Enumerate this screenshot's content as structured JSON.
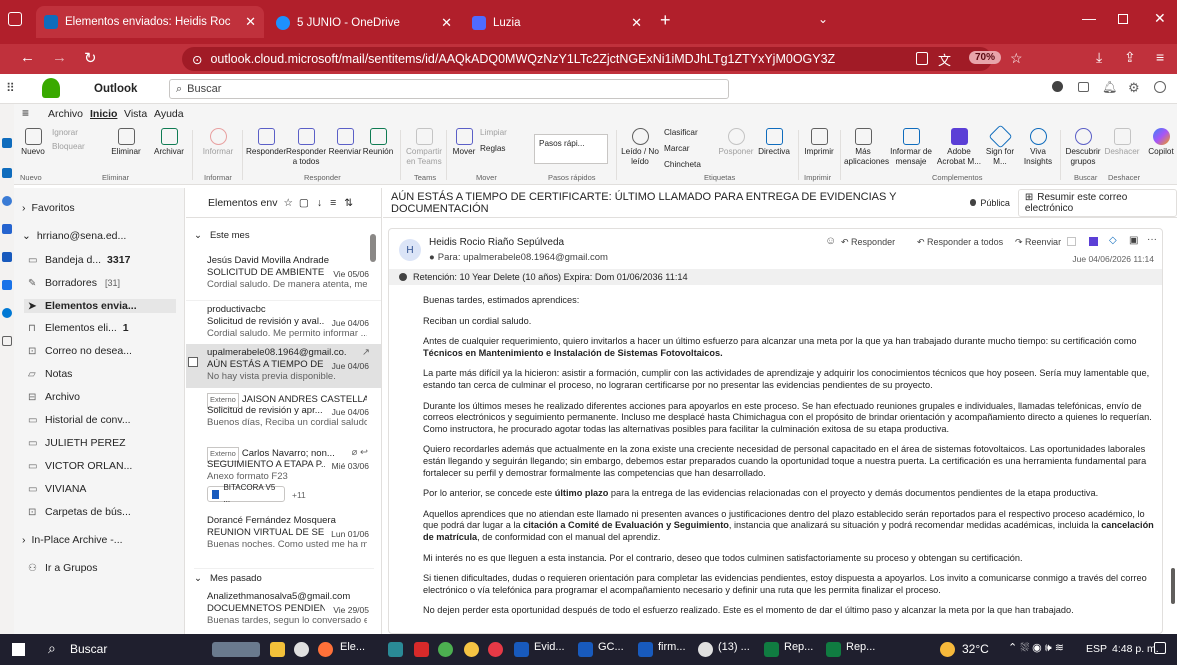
{
  "browser": {
    "tabs": [
      {
        "title": "Elementos enviados: Heidis Roc"
      },
      {
        "title": "5 JUNIO - OneDrive"
      },
      {
        "title": "Luzia"
      }
    ],
    "url": "outlook.cloud.microsoft/mail/sentitems/id/AAQkADQ0MWQzNzY1LTc2ZjctNGExNi1iMDJhLTg1ZTYxYjM0OGY3Z",
    "zoom": "70%"
  },
  "outlook": {
    "app_name": "Outlook",
    "search_placeholder": "Buscar",
    "menu": [
      "Archivo",
      "Inicio",
      "Vista",
      "Ayuda"
    ],
    "ribbon": {
      "nuevo": "Nuevo",
      "ignorar": "Ignorar",
      "bloquear": "Bloquear",
      "eliminar": "Eliminar",
      "archivar": "Archivar",
      "informar": "Informar",
      "responder": "Responder",
      "responder_todos": "Responder a todos",
      "reenviar": "Reenviar",
      "reunion": "Reunión",
      "compartir_teams": "Compartir en Teams",
      "mover": "Mover",
      "limpiar": "Limpiar",
      "reglas": "Reglas",
      "pasos_rapidos": "Pasos rápi...",
      "leido": "Leído / No leído",
      "clasificar": "Clasificar",
      "marcar": "Marcar",
      "chincheta": "Chincheta",
      "posponer": "Posponer",
      "directiva": "Directiva",
      "imprimir": "Imprimir",
      "mas_aplicaciones": "Más aplicaciones",
      "informar_mensaje": "Informar de mensaje",
      "adobe": "Adobe Acrobat M...",
      "sign_for": "Sign for M...",
      "viva_insights": "Viva Insights",
      "descubrir": "Descubrir grupos",
      "deshacer": "Deshacer",
      "copilot": "Copilot",
      "groups": {
        "nuevo": "Nuevo",
        "eliminar": "Eliminar",
        "informar": "Informar",
        "responder": "Responder",
        "teams": "Teams",
        "mover": "Mover",
        "pasos": "Pasos rápidos",
        "etiquetas": "Etiquetas",
        "imprimir": "Imprimir",
        "complementos": "Complementos",
        "buscar": "Buscar",
        "deshacer": "Deshacer"
      }
    },
    "folders": {
      "favoritos": "Favoritos",
      "account": "hrriano@sena.ed...",
      "items": [
        {
          "label": "Bandeja d...",
          "count": "3317"
        },
        {
          "label": "Borradores",
          "count": "[31]"
        },
        {
          "label": "Elementos envia...",
          "count": ""
        },
        {
          "label": "Elementos eli...",
          "count": "1"
        },
        {
          "label": "Correo no desea...",
          "count": ""
        },
        {
          "label": "Notas",
          "count": ""
        },
        {
          "label": "Archivo",
          "count": ""
        },
        {
          "label": "Historial de conv...",
          "count": ""
        },
        {
          "label": "JULIETH PEREZ",
          "count": ""
        },
        {
          "label": "VICTOR ORLAN...",
          "count": ""
        },
        {
          "label": "VIVIANA",
          "count": ""
        },
        {
          "label": "Carpetas de bús...",
          "count": ""
        }
      ],
      "in_place": "In-Place Archive -...",
      "grupos": "Ir a Grupos"
    },
    "list": {
      "header": "Elementos env",
      "this_month": "Este mes",
      "last_month": "Mes pasado",
      "messages": [
        {
          "sender": "Jesús David Movilla Andrade",
          "subject": "SOLICITUD DE AMBIENTE ...",
          "date": "Vie 05/06",
          "preview": "Cordial saludo. De manera atenta, me..."
        },
        {
          "sender": "productivacbc",
          "subject": "Solicitud de revisión y aval...",
          "date": "Jue 04/06",
          "preview": "Cordial saludo. Me permito informar ..."
        },
        {
          "sender": "upalmerabele08.1964@gmail.co...",
          "subject": "AÚN ESTÁS A TIEMPO DE ...",
          "date": "Jue 04/06",
          "preview": "No hay vista previa disponible."
        },
        {
          "external": "Externo",
          "sender": "JAISON ANDRES CASTELLA...",
          "subject": "Solicitud de revisión y apr...",
          "date": "Jue 04/06",
          "preview": "Buenos días, Reciba un cordial saludo..."
        },
        {
          "external": "Externo",
          "sender": "Carlos Navarro; non...",
          "subject": "SEGUIMIENTO A ETAPA P...",
          "date": "Mié 03/06",
          "preview": "Anexo formato F23",
          "attachment": "BITACORA V5 ...",
          "more": "+11"
        },
        {
          "sender": "Dorancé Fernández Mosquera",
          "subject": "REUNION VIRTUAL DE SE...",
          "date": "Lun 01/06",
          "preview": "Buenas noches. Como usted me ha m..."
        },
        {
          "sender": "Analizethmanosalva5@gmail.com",
          "subject": "DOCUEMNETOS PENDIEN...",
          "date": "Vie 29/05",
          "preview": "Buenas tardes, segun lo conversado e..."
        }
      ]
    },
    "reading": {
      "subject": "AÚN ESTÁS A TIEMPO DE CERTIFICARTE: ÚLTIMO LLAMADO PARA ENTREGA DE EVIDENCIAS Y DOCUMENTACIÓN",
      "tag": "Pública",
      "summary": "Resumir este correo electrónico",
      "avatar": "H",
      "from": "Heidis Rocio Riaño Sepúlveda",
      "to": "Para:  upalmerabele08.1964@gmail.com",
      "date": "Jue 04/06/2026 11:14",
      "actions": {
        "responder": "Responder",
        "responder_todos": "Responder a todos",
        "reenviar": "Reenviar"
      },
      "retention": "Retención: 10 Year Delete (10 años) Expira: Dom 01/06/2036 11:14",
      "body": {
        "p1": "Buenas tardes, estimados aprendices:",
        "p2": "Reciban un cordial saludo.",
        "p3a": "Antes de cualquier requerimiento, quiero invitarlos a hacer un último esfuerzo para alcanzar una meta por la que ya han trabajado durante mucho tiempo: su certificación como ",
        "p3b": "Técnicos en Mantenimiento e Instalación de Sistemas Fotovoltaicos.",
        "p4": "La parte más difícil ya la hicieron: asistir a formación, cumplir con las actividades de aprendizaje y adquirir los conocimientos técnicos que hoy poseen. Sería muy lamentable que, estando tan cerca de culminar el proceso, no lograran certificarse por no presentar las evidencias pendientes de su proyecto.",
        "p5": "Durante los últimos meses he realizado diferentes acciones para apoyarlos en este proceso. Se han efectuado reuniones grupales e individuales, llamadas telefónicas, envío de correos electrónicos y seguimiento permanente. Incluso me desplacé hasta Chimichagua con el propósito de brindar orientación y acompañamiento directo a quienes lo requerían. Como instructora, he procurado agotar todas las alternativas posibles para facilitar la culminación exitosa de su etapa productiva.",
        "p6": "Quiero recordarles además que actualmente en la zona existe una creciente necesidad de personal capacitado en el área de sistemas fotovoltaicos. Las oportunidades laborales están llegando y seguirán llegando; sin embargo, debemos estar preparados cuando la oportunidad toque a nuestra puerta. La certificación es una herramienta fundamental para fortalecer su perfil y demostrar formalmente las competencias que han desarrollado.",
        "p7a": "Por lo anterior, se concede este ",
        "p7b": "último plazo",
        "p7c": " para la entrega de las evidencias relacionadas con el proyecto y demás documentos pendientes de la etapa productiva.",
        "p8a": "Aquellos aprendices que no atiendan este llamado ni presenten avances o justificaciones dentro del plazo establecido serán reportados para el respectivo proceso académico, lo que podrá dar lugar a la ",
        "p8b": "citación a Comité de Evaluación y Seguimiento",
        "p8c": ", instancia que analizará su situación y podrá recomendar medidas académicas, incluida la ",
        "p8d": "cancelación de matrícula",
        "p8e": ", de conformidad con el manual del aprendiz.",
        "p9": "Mi interés no es que lleguen a esta instancia. Por el contrario, deseo que todos culminen satisfactoriamente su proceso y obtengan su certificación.",
        "p10": "Si tienen dificultades, dudas o requieren orientación para completar las evidencias pendientes, estoy dispuesta a apoyarlos. Los invito a comunicarse conmigo a través del correo electrónico o vía telefónica para programar el acompañamiento necesario y definir una ruta que les permita finalizar el proceso.",
        "p11": "No dejen perder esta oportunidad después de todo el esfuerzo realizado. Este es el momento de dar el último paso y alcanzar la meta por la que han trabajado."
      }
    }
  },
  "taskbar": {
    "search": "Buscar",
    "apps": [
      "Ele...",
      "Evid...",
      "GC...",
      "firm...",
      "(13) ...",
      "Rep...",
      "Rep..."
    ],
    "weather": "32°C",
    "lang": "ESP",
    "time": "4:48 p. m."
  },
  "colors": {
    "browser_red": "#b11f2b",
    "accent": "#0f6cbd",
    "taskbar": "#1f1f2e"
  }
}
